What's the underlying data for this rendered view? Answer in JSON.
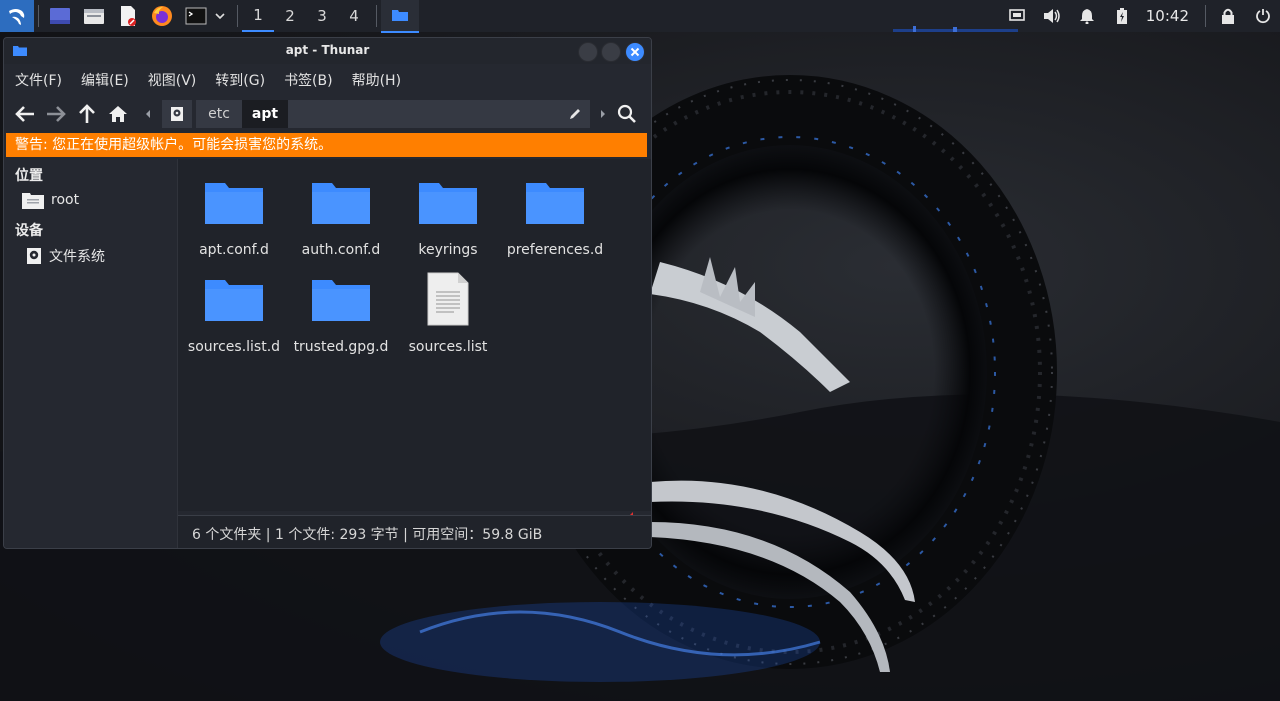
{
  "panel": {
    "workspaces": [
      "1",
      "2",
      "3",
      "4"
    ],
    "clock": "10:42"
  },
  "window": {
    "title": "apt - Thunar",
    "menu": [
      "文件(F)",
      "编辑(E)",
      "视图(V)",
      "转到(G)",
      "书签(B)",
      "帮助(H)"
    ],
    "path": [
      "etc",
      "apt"
    ],
    "warning": "警告: 您正在使用超级帐户。可能会损害您的系统。",
    "sidebar": {
      "places_heading": "位置",
      "places": [
        {
          "label": "root",
          "icon": "home-folder-icon"
        }
      ],
      "devices_heading": "设备",
      "devices": [
        {
          "label": "文件系统",
          "icon": "drive-icon"
        }
      ]
    },
    "files": [
      {
        "name": "apt.conf.d",
        "type": "folder"
      },
      {
        "name": "auth.conf.d",
        "type": "folder"
      },
      {
        "name": "keyrings",
        "type": "folder"
      },
      {
        "name": "preferences.d",
        "type": "folder"
      },
      {
        "name": "sources.list.d",
        "type": "folder"
      },
      {
        "name": "trusted.gpg.d",
        "type": "folder"
      },
      {
        "name": "sources.list",
        "type": "text-file"
      }
    ],
    "status": "6 个文件夹 | 1 个文件: 293 字节 | 可用空间：59.8 GiB"
  },
  "colors": {
    "accent": "#3d8bff",
    "folder": "#3d8bff",
    "warning_bg": "#ff7f00",
    "annotation_arrow": "#e03030"
  }
}
